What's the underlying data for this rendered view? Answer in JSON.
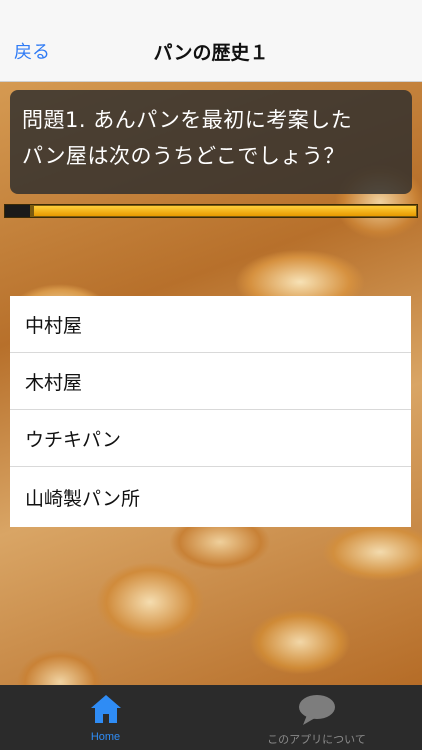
{
  "nav": {
    "back_label": "戻る",
    "title": "パンの歴史１"
  },
  "question": {
    "line1": "問題1. あんパンを最初に考案した",
    "line2": "パン屋は次のうちどこでしょう？"
  },
  "progress": {
    "fraction": 0.06
  },
  "answers": [
    {
      "label": "中村屋"
    },
    {
      "label": "木村屋"
    },
    {
      "label": "ウチキパン"
    },
    {
      "label": "山崎製パン所"
    }
  ],
  "tabbar": {
    "home_label": "Home",
    "about_label": "このアプリについて",
    "home_icon": "home-icon",
    "about_icon": "speech-bubble-icon",
    "active_color": "#2f8cf5",
    "inactive_color": "#8a8a8a"
  }
}
